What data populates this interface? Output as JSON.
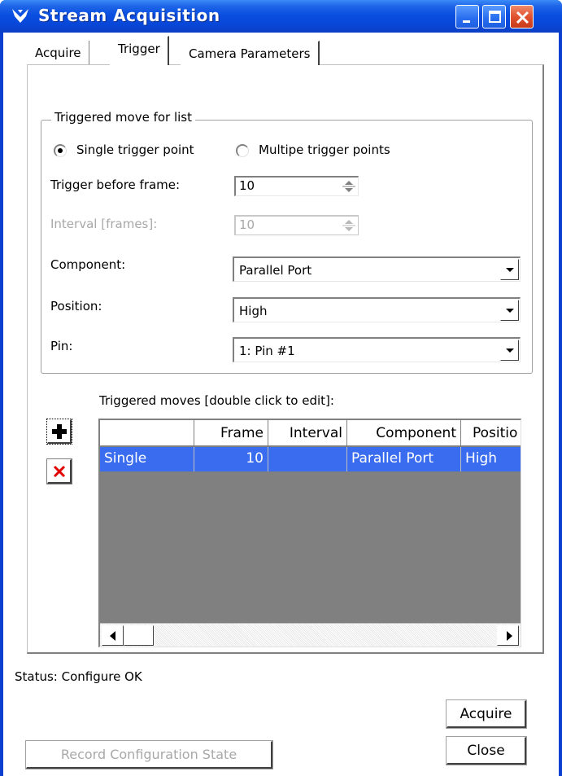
{
  "window": {
    "title": "Stream Acquisition"
  },
  "tabs": [
    {
      "label": "Acquire"
    },
    {
      "label": "Trigger"
    },
    {
      "label": "Camera Parameters"
    }
  ],
  "trigger": {
    "group_title": "Triggered move for list",
    "radio_single_label": "Single trigger point",
    "radio_multiple_label": "Multipe trigger points",
    "selected_mode": "single",
    "trigger_before_label": "Trigger before frame:",
    "trigger_before_value": "10",
    "interval_label": "Interval [frames]:",
    "interval_value": "10",
    "component_label": "Component:",
    "component_value": "Parallel Port",
    "position_label": "Position:",
    "position_value": "High",
    "pin_label": "Pin:",
    "pin_value": "1: Pin #1"
  },
  "moves": {
    "title": "Triggered moves [double click to edit]:",
    "columns": [
      "",
      "Frame",
      "Interval",
      "Component",
      "Positio"
    ],
    "rows": [
      [
        "Single",
        "10",
        "",
        "Parallel Port",
        "High"
      ]
    ]
  },
  "status": {
    "text": "Status: Configure OK"
  },
  "buttons": {
    "acquire": "Acquire",
    "close": "Close",
    "record": "Record Configuration State"
  },
  "colors": {
    "titlebar": "#0a4fe0",
    "selection": "#3a6cf0",
    "grid_background": "#808080",
    "close_button": "#e0522f"
  }
}
